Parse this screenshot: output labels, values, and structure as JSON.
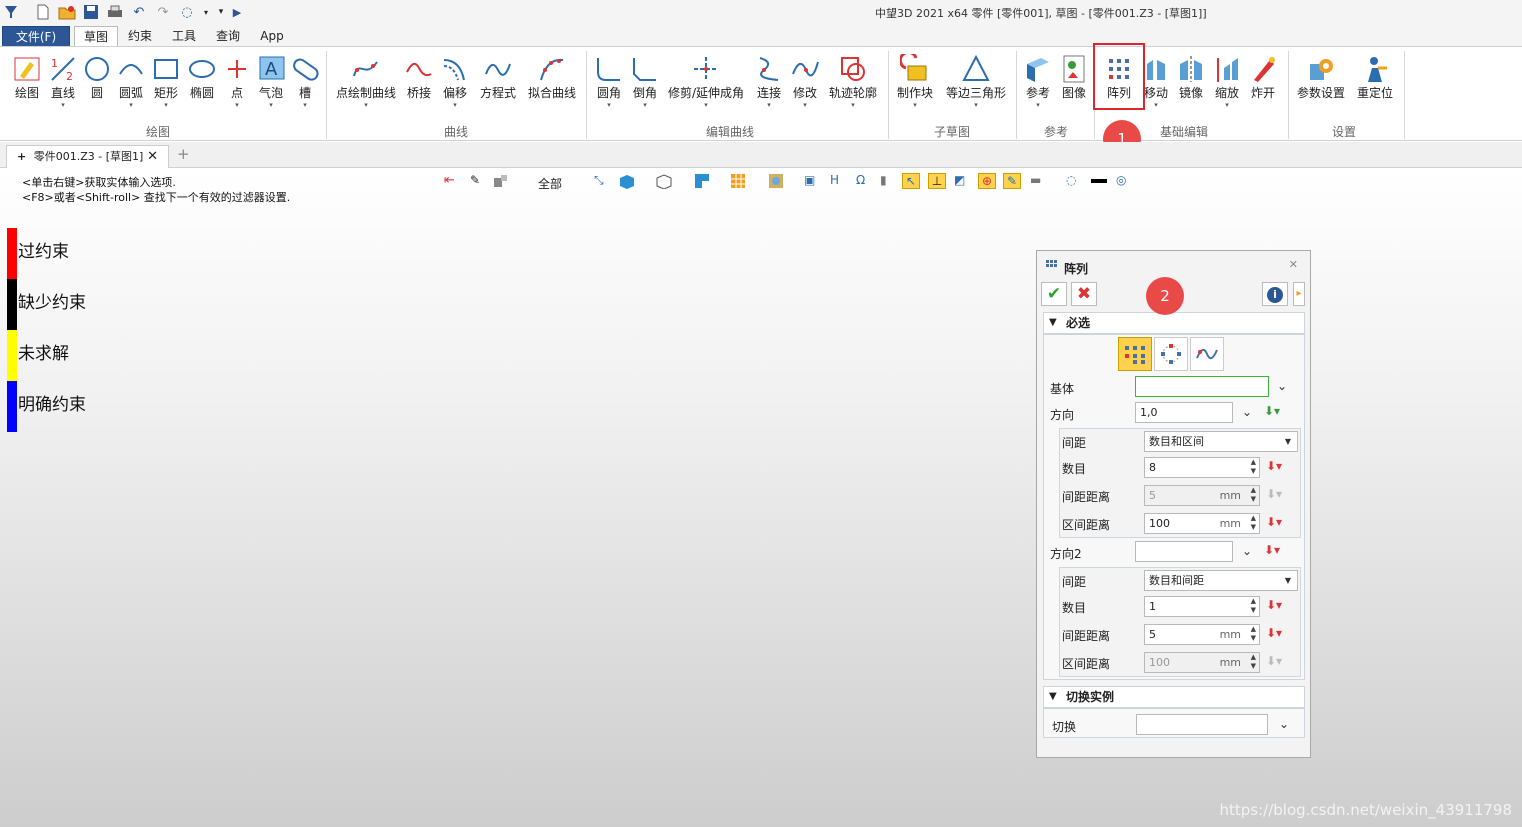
{
  "window": {
    "title": "中望3D 2021 x64      零件 [零件001], 草图 - [零件001.Z3 - [草图1]]"
  },
  "menu": {
    "file": "文件(F)",
    "tabs": [
      "草图",
      "约束",
      "工具",
      "查询",
      "App"
    ]
  },
  "ribbon": {
    "groups": [
      "绘图",
      "曲线",
      "编辑曲线",
      "子草图",
      "参考",
      "基础编辑",
      "设置"
    ],
    "draw": [
      "绘图",
      "直线",
      "圆",
      "圆弧",
      "矩形",
      "椭圆",
      "点",
      "气泡",
      "槽"
    ],
    "curve": [
      "点绘制曲线",
      "桥接",
      "偏移",
      "方程式",
      "拟合曲线"
    ],
    "edit_curve": [
      "圆角",
      "倒角",
      "修剪/延伸成角",
      "连接",
      "修改",
      "轨迹轮廓"
    ],
    "sub_sketch": [
      "制作块",
      "等边三角形"
    ],
    "reference": [
      "参考",
      "图像"
    ],
    "basic_edit": [
      "阵列",
      "移动",
      "镜像",
      "缩放",
      "炸开"
    ],
    "settings": [
      "参数设置",
      "重定位"
    ]
  },
  "doc_tab": {
    "label": "零件001.Z3 - [草图1]"
  },
  "canvas": {
    "hints": [
      "<单击右键>获取实体输入选项.",
      "<F8>或者<Shift-roll> 查找下一个有效的过滤器设置."
    ],
    "filter": "全部",
    "legend": [
      {
        "label": "过约束",
        "color": "#ff0000"
      },
      {
        "label": "缺少约束",
        "color": "#000000"
      },
      {
        "label": "未求解",
        "color": "#ffff00"
      },
      {
        "label": "明确约束",
        "color": "#0000ff"
      }
    ]
  },
  "badges": [
    "1",
    "2"
  ],
  "dialog": {
    "title": "阵列",
    "required": {
      "header": "必选",
      "base_label": "基体",
      "base_value": "",
      "dir_label": "方向",
      "dir_value": "1,0",
      "dir1": {
        "spacing_label": "间距",
        "spacing_value": "数目和区间",
        "count_label": "数目",
        "count_value": "8",
        "spacing_dist_label": "间距距离",
        "spacing_dist_value": "5",
        "range_dist_label": "区间距离",
        "range_dist_value": "100",
        "unit": "mm"
      },
      "dir2_label": "方向2",
      "dir2_value": "",
      "dir2": {
        "spacing_label": "间距",
        "spacing_value": "数目和间距",
        "count_label": "数目",
        "count_value": "1",
        "spacing_dist_label": "间距距离",
        "spacing_dist_value": "5",
        "range_dist_label": "区间距离",
        "range_dist_value": "100",
        "unit": "mm"
      }
    },
    "toggle": {
      "header": "切换实例",
      "label": "切换",
      "value": ""
    }
  },
  "watermark": "https://blog.csdn.net/weixin_43911798",
  "colors": {
    "accent": "#2b5797",
    "highlight": "#d9272d",
    "badge": "#e94a48",
    "active": "#ffd24d"
  }
}
